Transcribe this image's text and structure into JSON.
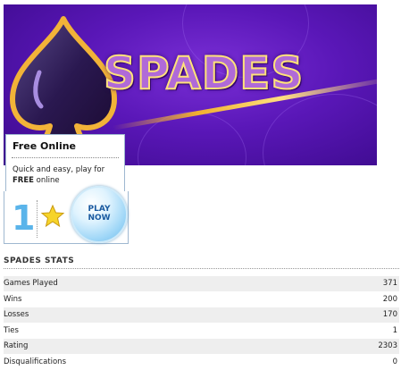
{
  "banner": {
    "logo_text": "SPADES"
  },
  "promo": {
    "title": "Free Online",
    "desc_pre": "Quick and easy, play for ",
    "desc_bold": "FREE",
    "desc_post": " online",
    "number": "1",
    "play_label": "PLAY\nNOW"
  },
  "stats": {
    "title": "SPADES STATS",
    "rows": [
      {
        "label": "Games Played",
        "value": "371"
      },
      {
        "label": "Wins",
        "value": "200"
      },
      {
        "label": "Losses",
        "value": "170"
      },
      {
        "label": "Ties",
        "value": "1"
      },
      {
        "label": "Rating",
        "value": "2303"
      },
      {
        "label": "Disqualifications",
        "value": "0"
      }
    ]
  },
  "colors": {
    "banner_purple": "#5a17b8",
    "logo_gold": "#ffe27a",
    "number_blue": "#5ab4ea",
    "star_yellow": "#f6d42a"
  },
  "icons": {
    "spade": "spade-icon",
    "star": "star-icon"
  }
}
